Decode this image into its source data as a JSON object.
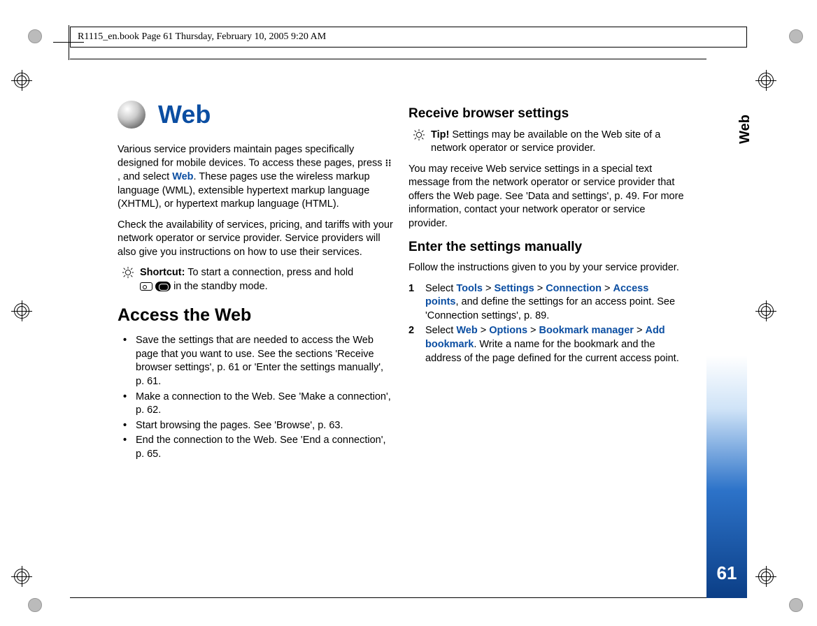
{
  "header": "R1115_en.book  Page 61  Thursday, February 10, 2005  9:20 AM",
  "tab": {
    "label": "Web",
    "page": "61"
  },
  "title": "Web",
  "col1": {
    "intro1a": "Various service providers maintain pages specifically designed for mobile devices. To access these pages, press ",
    "intro1b": " , and select ",
    "intro1link": "Web",
    "intro1c": ". These pages use the wireless markup language (WML), extensible hypertext markup language (XHTML), or hypertext markup language (HTML).",
    "intro2": "Check the availability of services, pricing, and tariffs with your network operator or service provider. Service providers will also give you instructions on how to use their services.",
    "shortcut_label": "Shortcut:",
    "shortcut_text_a": " To start a connection, press and hold ",
    "shortcut_text_b": " in the standby mode.",
    "h2": "Access the Web",
    "bullets": [
      "Save the settings that are needed to access the Web page that you want to use. See the sections 'Receive browser settings', p. 61 or 'Enter the settings manually', p. 61.",
      "Make a connection to the Web. See 'Make a connection', p. 62.",
      "Start browsing the pages. See 'Browse', p. 63.",
      "End the connection to the Web. See 'End a connection', p. 65."
    ]
  },
  "col2": {
    "h3a": "Receive browser settings",
    "tip_label": "Tip!",
    "tip_text": " Settings may be available on the Web site of a network operator or service provider.",
    "p1": "You may receive Web service settings in a special text message from the network operator or service provider that offers the Web page. See 'Data and settings', p. 49. For more information, contact your network operator or service provider.",
    "h3b": "Enter the settings manually",
    "p2": "Follow the instructions given to you by your service provider.",
    "step1_pre": "Select ",
    "step1_links": [
      "Tools",
      "Settings",
      "Connection",
      "Access points"
    ],
    "step1_post": ", and define the settings for an access point. See 'Connection settings', p. 89.",
    "step2_pre": "Select ",
    "step2_links": [
      "Web",
      "Options",
      "Bookmark manager",
      "Add bookmark"
    ],
    "step2_post": ". Write a name for the bookmark and the address of the page defined for the current access point."
  }
}
